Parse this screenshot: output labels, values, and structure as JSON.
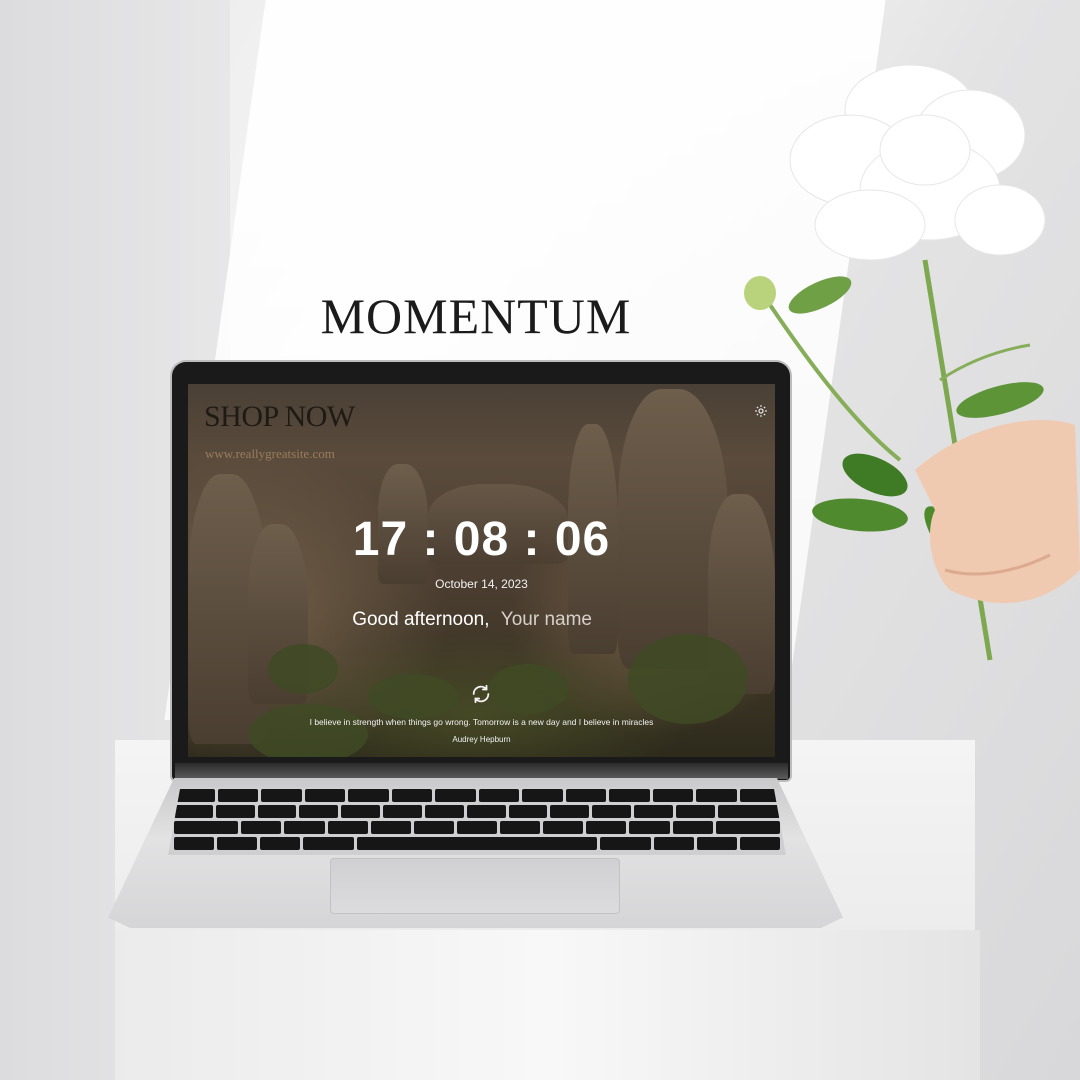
{
  "brand": {
    "title": "MOMENTUM"
  },
  "screen": {
    "shop_title": "SHOP NOW",
    "shop_url": "www.reallygreatsite.com",
    "settings_icon": "gear-icon",
    "clock": "17 : 08 : 06",
    "date": "October 14, 2023",
    "greeting": "Good afternoon,",
    "name_placeholder": "Your name",
    "refresh_icon": "refresh-icon",
    "quote": "I believe in strength when things go wrong. Tomorrow is a new day and I believe in miracles",
    "author": "Audrey Hepburn"
  },
  "colors": {
    "title": "#1b1b1b",
    "clock": "#ffffff",
    "url": "#9b7c5c"
  }
}
